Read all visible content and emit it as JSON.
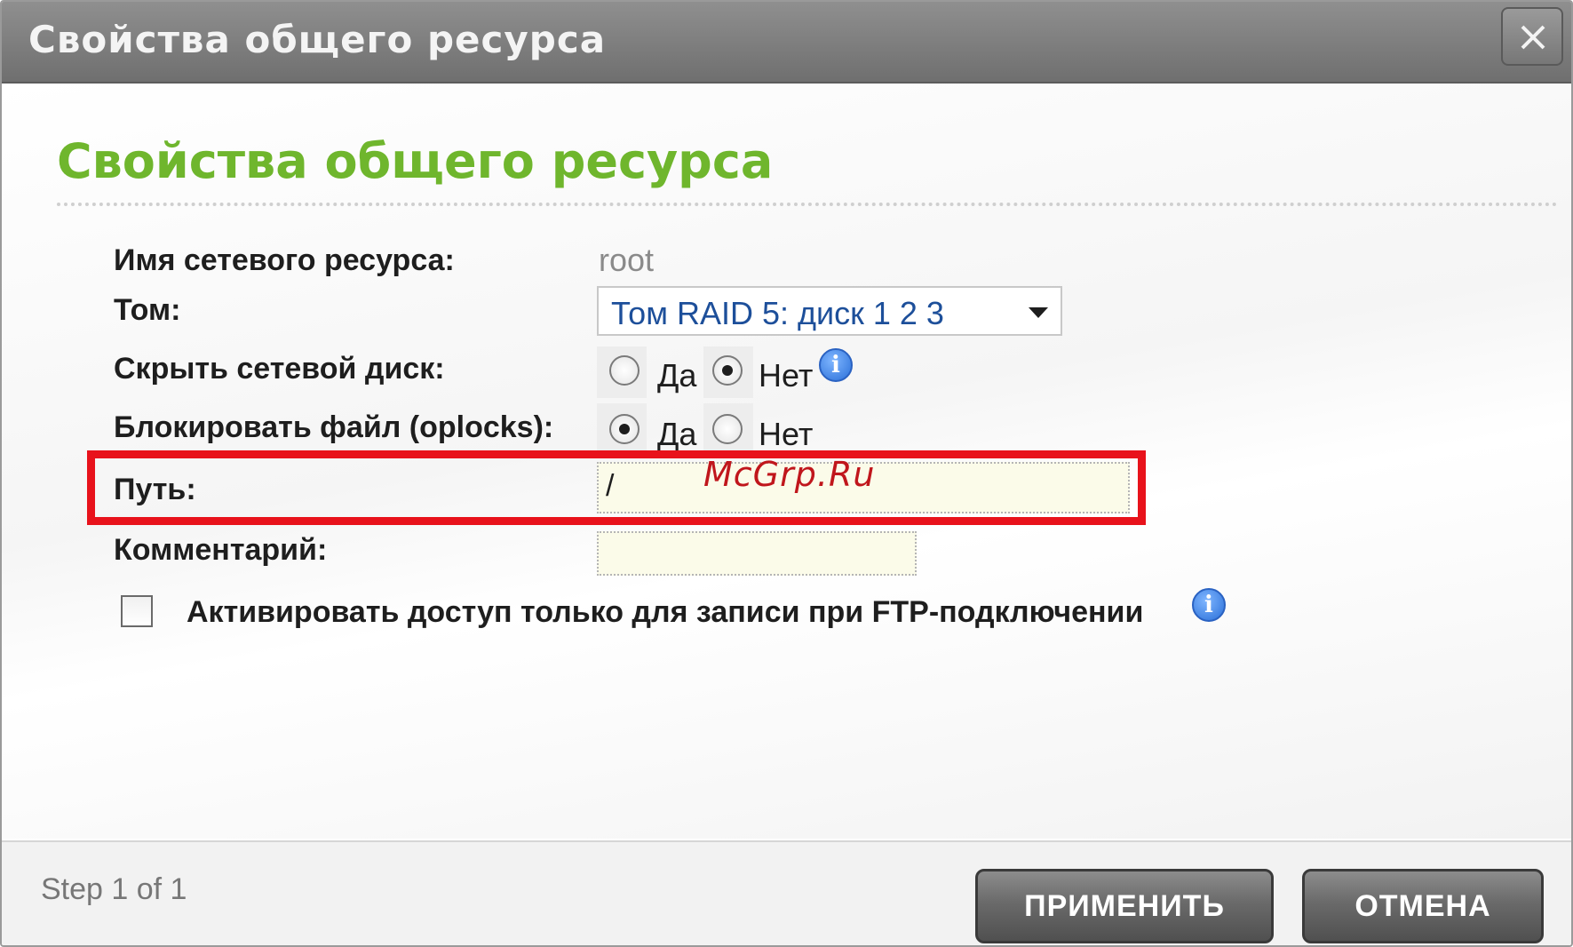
{
  "window": {
    "title": "Свойства общего ресурса",
    "close_label": "X"
  },
  "form": {
    "heading": "Свойства общего ресурса",
    "share_name_label": "Имя сетевого ресурса:",
    "share_name_value": "root",
    "volume_label": "Том:",
    "volume_value": "Том RAID 5: диск  1  2  3",
    "hide_label": "Скрыть сетевой диск:",
    "hide_options": [
      {
        "label": "Да",
        "checked": false
      },
      {
        "label": "Нет",
        "checked": true
      }
    ],
    "oplocks_label": "Блокировать файл (oplocks):",
    "oplocks_options": [
      {
        "label": "Да",
        "checked": true
      },
      {
        "label": "Нет",
        "checked": false
      }
    ],
    "path_label": "Путь:",
    "path_value": "/",
    "comment_label": "Комментарий:",
    "comment_value": "",
    "ftp_checkbox_label": "Активировать доступ только для записи при FTP-подключении",
    "ftp_checkbox_checked": false,
    "info_glyph": "i"
  },
  "watermark": "McGrp.Ru",
  "footer": {
    "step_text": "Step 1 of 1",
    "apply_label": "ПРИМЕНИТЬ",
    "cancel_label": "ОТМЕНА"
  },
  "colors": {
    "heading": "#6fb62d",
    "highlight": "#e8121b",
    "titlebar": "#7f7f7f"
  },
  "icons": [
    "close-icon",
    "dropdown-arrow-icon",
    "info-icon"
  ]
}
